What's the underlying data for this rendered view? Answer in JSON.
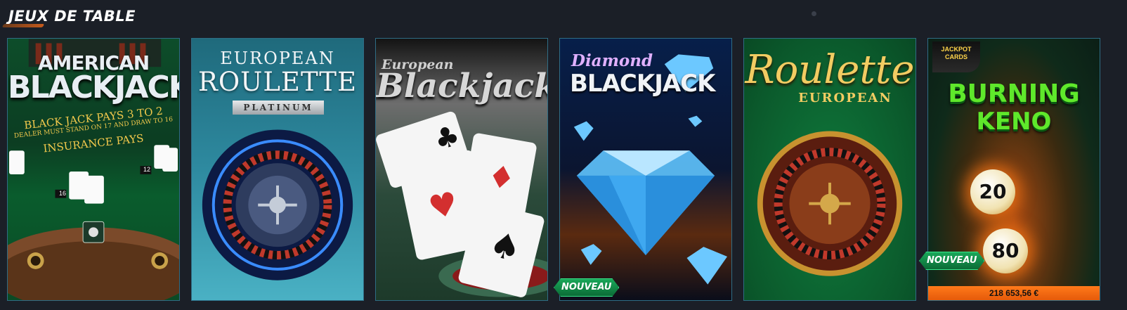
{
  "section": {
    "title": "JEUX DE TABLE"
  },
  "games": [
    {
      "title_top": "AMERICAN",
      "title_main": "BLACKJACK",
      "table_text": [
        "BLACK JACK PAYS 3 TO 2",
        "DEALER MUST STAND ON 17 AND DRAW TO 16",
        "INSURANCE PAYS"
      ],
      "hand_values": [
        "16",
        "12"
      ]
    },
    {
      "title_top": "EUROPEAN",
      "title_main": "ROULETTE",
      "edition": "PLATINUM"
    },
    {
      "title_top": "European",
      "title_main": "Blackjack"
    },
    {
      "title_top": "Diamond",
      "title_main": "BLACKJACK",
      "badge": "NOUVEAU"
    },
    {
      "title_main": "Roulette",
      "title_sub": "EUROPEAN"
    },
    {
      "brand_line1": "JACKPOT",
      "brand_line2": "CARDS",
      "title_top": "BURNING",
      "title_main": "KENO",
      "balls": [
        "20",
        "80"
      ],
      "badge": "NOUVEAU",
      "jackpot": "218 653,56 €"
    }
  ],
  "colors": {
    "accent_border": "#2f6d85",
    "badge_green": "#1aa85a",
    "jackpot_orange": "#ff7a1a"
  }
}
